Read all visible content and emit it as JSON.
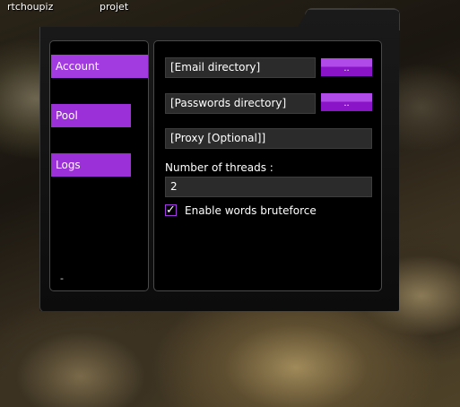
{
  "desktop": {
    "labels": [
      "rtchoupiz",
      "projet"
    ]
  },
  "nav": {
    "items": [
      {
        "label": "Account",
        "active": true
      },
      {
        "label": "Pool"
      },
      {
        "label": "Logs"
      }
    ],
    "footer_text": "-"
  },
  "form": {
    "email_dir": {
      "value": "[Email directory]",
      "button_label": ".."
    },
    "passwords_dir": {
      "value": "[Passwords directory]",
      "button_label": ".."
    },
    "proxy": {
      "value": "[Proxy [Optional]]"
    },
    "threads": {
      "label": "Number of threads :",
      "value": "2"
    },
    "bruteforce": {
      "label": "Enable words bruteforce",
      "checked": true,
      "check_glyph": "✓"
    }
  },
  "colors": {
    "accent": "#9b2fd8",
    "panel_bg": "#000000",
    "field_bg": "#2b2b2b"
  }
}
